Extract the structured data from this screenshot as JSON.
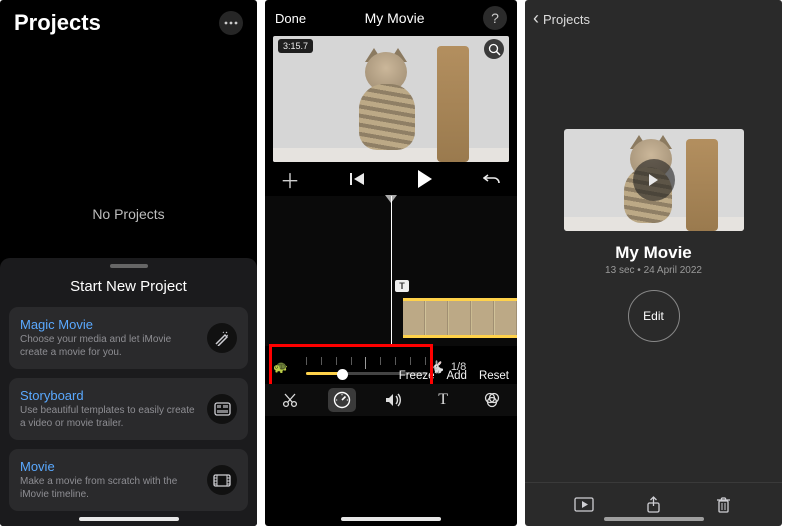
{
  "left_pane": {
    "title": "Projects",
    "empty_text": "No Projects",
    "start_header": "Start New Project",
    "options": [
      {
        "title": "Magic Movie",
        "subtitle": "Choose your media and let iMovie create a movie for you.",
        "icon": "wand-icon"
      },
      {
        "title": "Storyboard",
        "subtitle": "Use beautiful templates to easily create a video or movie trailer.",
        "icon": "storyboard-icon"
      },
      {
        "title": "Movie",
        "subtitle": "Make a movie from scratch with the iMovie timeline.",
        "icon": "film-icon"
      }
    ]
  },
  "editor": {
    "done_label": "Done",
    "title": "My Movie",
    "help_label": "?",
    "duration_badge": "3:15.7",
    "clip_tag": "T",
    "speed": {
      "rate_label": "1/8",
      "fill_pct": 30
    },
    "actions": {
      "freeze": "Freeze",
      "add": "Add",
      "reset": "Reset"
    },
    "tools": [
      "cut-icon",
      "speed-icon",
      "volume-icon",
      "title-icon",
      "filters-icon"
    ]
  },
  "detail": {
    "back_label": "Projects",
    "name": "My Movie",
    "subtitle": "13 sec • 24 April 2022",
    "edit_label": "Edit"
  }
}
